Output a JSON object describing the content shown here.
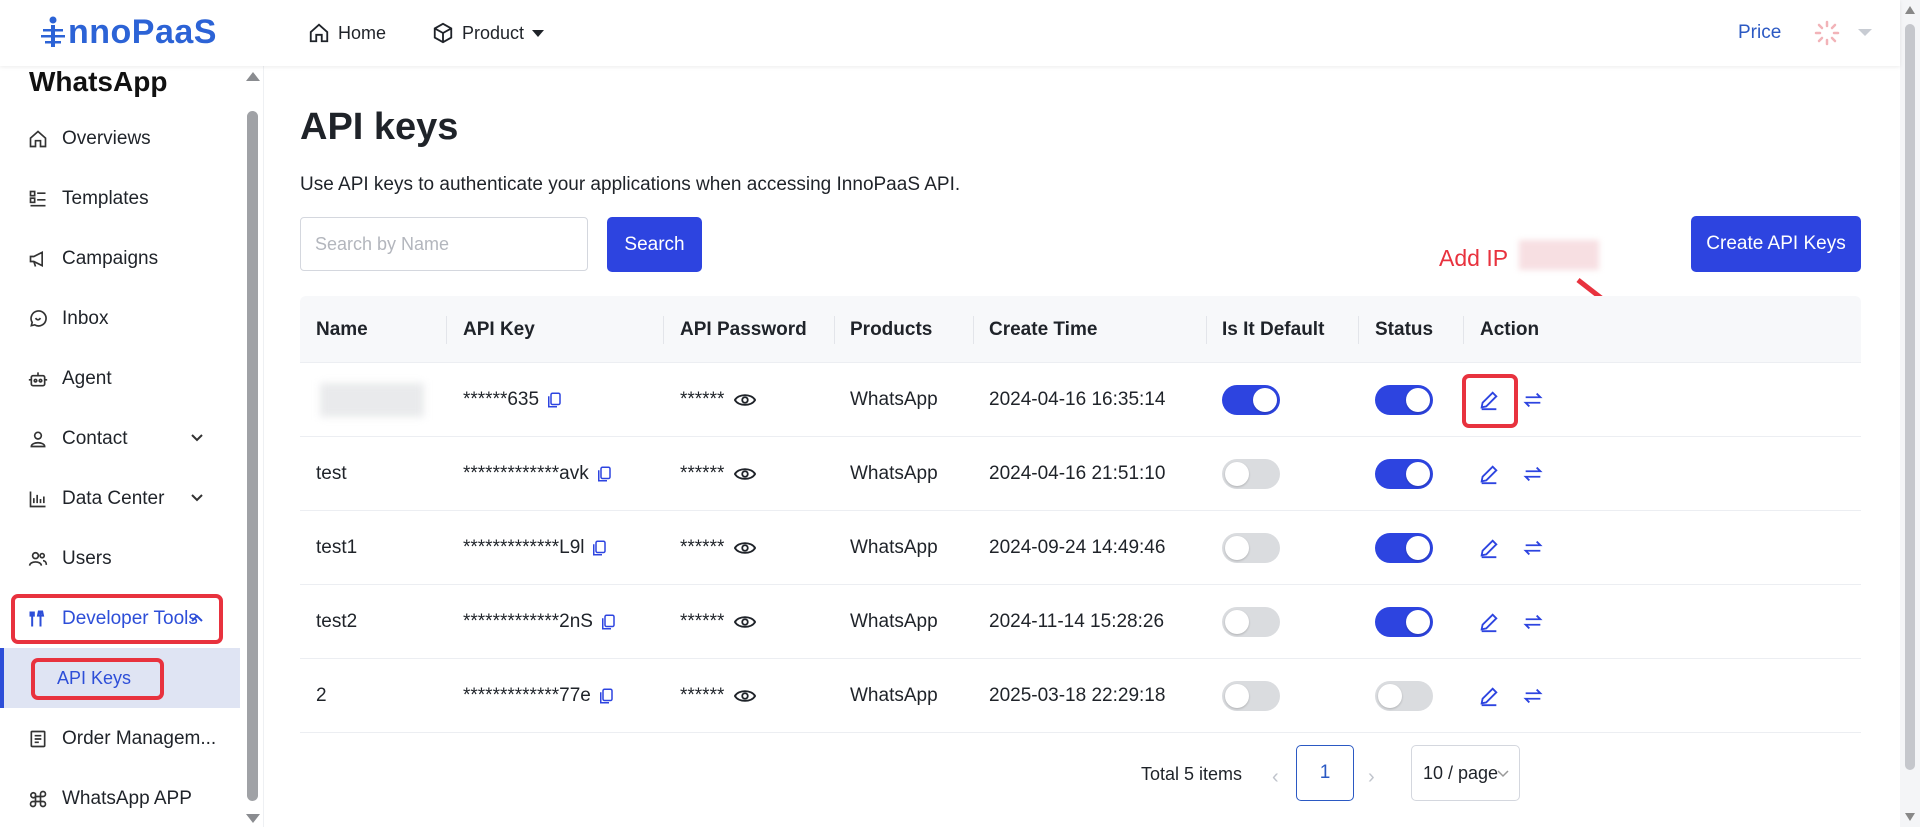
{
  "header": {
    "logo_text": "nnoPaaS",
    "nav_home": "Home",
    "nav_product": "Product",
    "price": "Price"
  },
  "sidebar": {
    "title": "WhatsApp",
    "items": [
      {
        "label": "Overviews",
        "icon": "home-icon"
      },
      {
        "label": "Templates",
        "icon": "templates-icon"
      },
      {
        "label": "Campaigns",
        "icon": "megaphone-icon"
      },
      {
        "label": "Inbox",
        "icon": "inbox-icon"
      },
      {
        "label": "Agent",
        "icon": "robot-icon"
      },
      {
        "label": "Contact",
        "icon": "contact-icon"
      },
      {
        "label": "Data Center",
        "icon": "chart-icon"
      },
      {
        "label": "Users",
        "icon": "users-icon"
      },
      {
        "label": "Developer Tools",
        "icon": "tools-icon"
      },
      {
        "label": "Order Managem...",
        "icon": "order-icon"
      },
      {
        "label": "WhatsApp APP",
        "icon": "app-icon"
      }
    ],
    "sub_item": "API Keys"
  },
  "main": {
    "title": "API keys",
    "description": "Use API keys to authenticate your applications when accessing InnoPaaS API.",
    "search_placeholder": "Search by Name",
    "search_button": "Search",
    "create_button": "Create API Keys",
    "annotation": "Add IP"
  },
  "table": {
    "columns": [
      "Name",
      "API Key",
      "API Password",
      "Products",
      "Create Time",
      "Is It Default",
      "Status",
      "Action"
    ],
    "rows": [
      {
        "name": "",
        "api_key": "******635",
        "password": "******",
        "product": "WhatsApp",
        "time": "2024-04-16 16:35:14",
        "is_default": true,
        "status": true
      },
      {
        "name": "test",
        "api_key": "*************avk",
        "password": "******",
        "product": "WhatsApp",
        "time": "2024-04-16 21:51:10",
        "is_default": false,
        "status": true
      },
      {
        "name": "test1",
        "api_key": "*************L9l",
        "password": "******",
        "product": "WhatsApp",
        "time": "2024-09-24 14:49:46",
        "is_default": false,
        "status": true
      },
      {
        "name": "test2",
        "api_key": "*************2nS",
        "password": "******",
        "product": "WhatsApp",
        "time": "2024-11-14 15:28:26",
        "is_default": false,
        "status": true
      },
      {
        "name": "2",
        "api_key": "*************77e",
        "password": "******",
        "product": "WhatsApp",
        "time": "2025-03-18 22:29:18",
        "is_default": false,
        "status": false
      }
    ]
  },
  "pagination": {
    "total": "Total 5 items",
    "current_page": "1",
    "page_size": "10 / page"
  },
  "colors": {
    "primary": "#2d44e0",
    "annotation": "#e8323e",
    "link": "#2b59c3"
  }
}
